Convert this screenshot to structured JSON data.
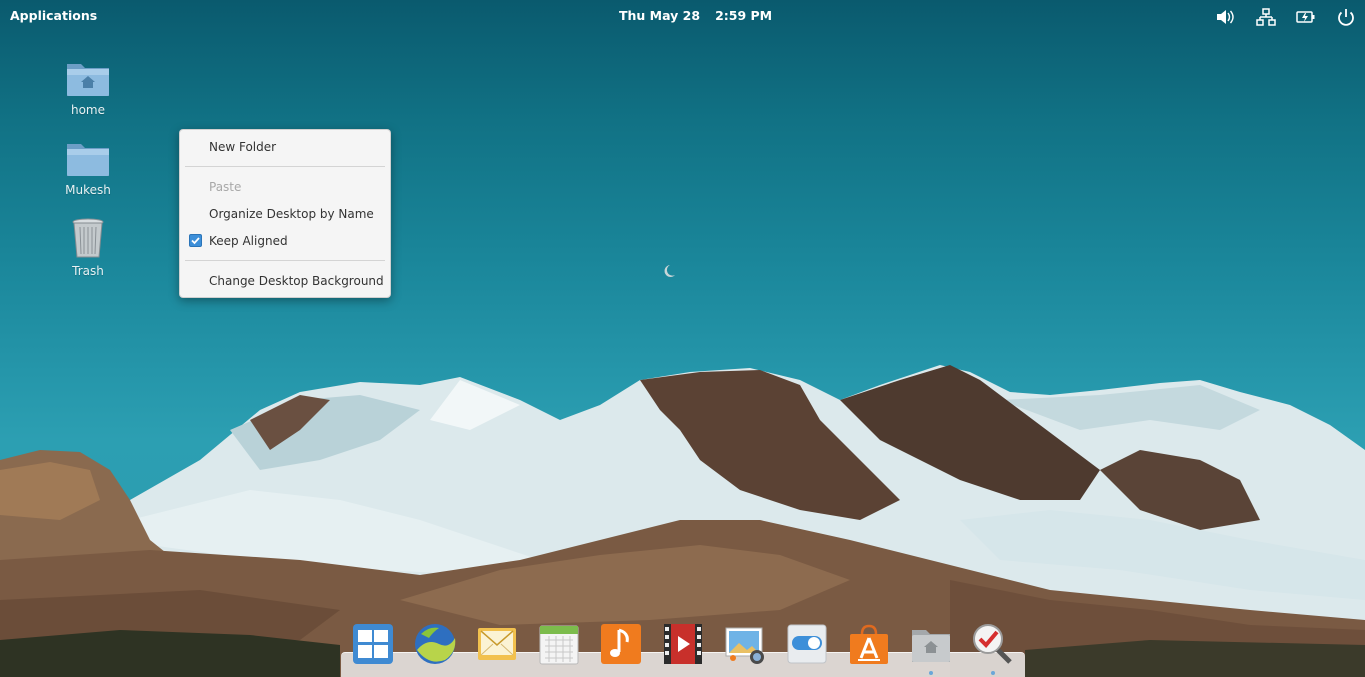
{
  "panel": {
    "applications_label": "Applications",
    "date": "Thu May 28",
    "time": "2:59 PM",
    "tray": [
      "volume-icon",
      "network-icon",
      "battery-icon",
      "power-icon"
    ]
  },
  "desktop_icons": [
    {
      "label": "home",
      "icon": "home-folder-icon"
    },
    {
      "label": "Mukesh",
      "icon": "folder-icon"
    },
    {
      "label": "Trash",
      "icon": "trash-icon"
    }
  ],
  "context_menu": {
    "new_folder": "New Folder",
    "paste": "Paste",
    "organize": "Organize Desktop by Name",
    "keep_aligned": "Keep Aligned",
    "keep_aligned_checked": true,
    "change_background": "Change Desktop Background"
  },
  "dock": {
    "apps": [
      "multitasking-view-icon",
      "web-browser-icon",
      "mail-icon",
      "calendar-icon",
      "music-icon",
      "videos-icon",
      "photos-icon",
      "settings-icon",
      "appcenter-icon",
      "files-icon",
      "screenshot-icon"
    ]
  },
  "colors": {
    "sky": "#117285",
    "menu_bg": "#f5f5f5",
    "accent": "#3d8fd9"
  }
}
